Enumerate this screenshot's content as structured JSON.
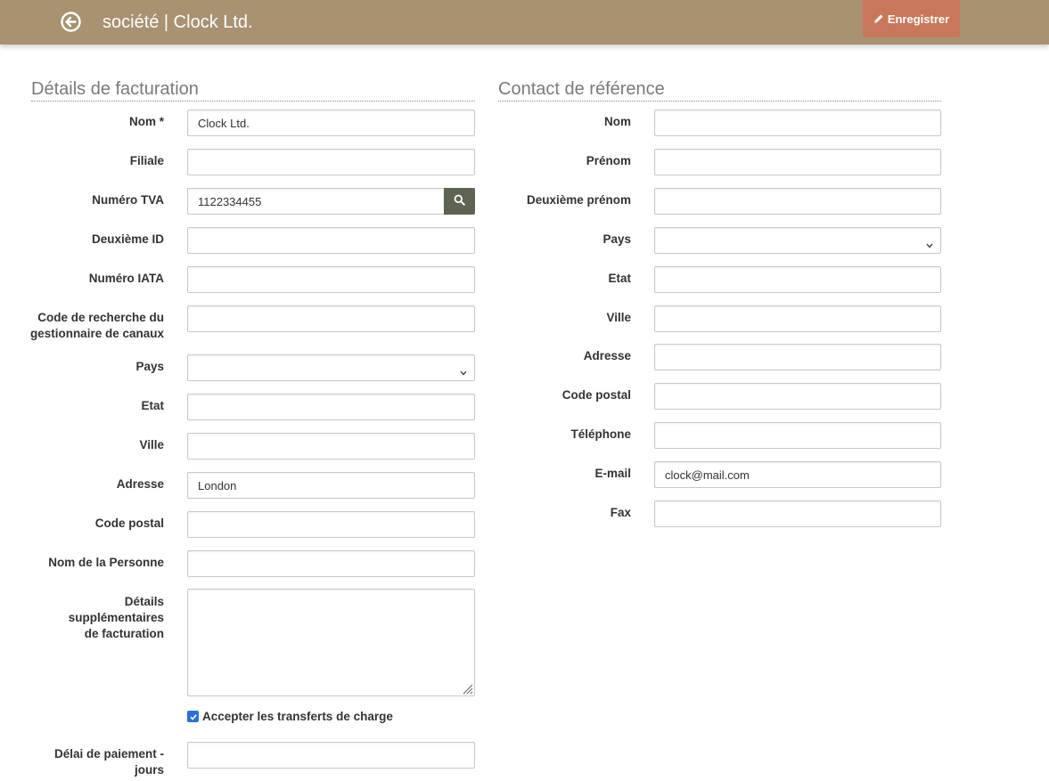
{
  "header": {
    "title": "société | Clock Ltd.",
    "back_icon": "back-circle-arrow-icon",
    "save_label": "Enregistrer",
    "save_icon": "pencil-icon",
    "bar_color": "#a89271",
    "save_color": "#c9775a"
  },
  "billing": {
    "section_title": "Détails de facturation",
    "fields": {
      "nom": {
        "label": "Nom *",
        "value": "Clock Ltd."
      },
      "filiale": {
        "label": "Filiale",
        "value": ""
      },
      "tva": {
        "label": "Numéro TVA",
        "value": "1122334455",
        "button_icon": "search-icon"
      },
      "deuxieme_id": {
        "label": "Deuxième ID",
        "value": ""
      },
      "iata": {
        "label": "Numéro IATA",
        "value": ""
      },
      "code_recherche": {
        "label_line1": "Code de recherche du",
        "label_line2": "gestionnaire de canaux",
        "value": ""
      },
      "pays": {
        "label": "Pays",
        "value": ""
      },
      "etat": {
        "label": "Etat",
        "value": ""
      },
      "ville": {
        "label": "Ville",
        "value": ""
      },
      "adresse": {
        "label": "Adresse",
        "value": "London"
      },
      "code_postal": {
        "label": "Code postal",
        "value": ""
      },
      "nom_personne": {
        "label": "Nom de la Personne",
        "value": ""
      },
      "details_supp": {
        "label_line1": "Détails supplémentaires",
        "label_line2": "de facturation",
        "value": ""
      },
      "transferts": {
        "label": "Accepter les transferts de charge",
        "checked": true
      },
      "delai": {
        "label_line1": "Délai de paiement -",
        "label_line2": "jours",
        "value": ""
      }
    }
  },
  "contact": {
    "section_title": "Contact de référence",
    "fields": {
      "nom": {
        "label": "Nom",
        "value": ""
      },
      "prenom": {
        "label": "Prénom",
        "value": ""
      },
      "deuxieme_prenom": {
        "label": "Deuxième prénom",
        "value": ""
      },
      "pays": {
        "label": "Pays",
        "value": ""
      },
      "etat": {
        "label": "Etat",
        "value": ""
      },
      "ville": {
        "label": "Ville",
        "value": ""
      },
      "adresse": {
        "label": "Adresse",
        "value": ""
      },
      "code_postal": {
        "label": "Code postal",
        "value": ""
      },
      "telephone": {
        "label": "Téléphone",
        "value": ""
      },
      "email": {
        "label": "E-mail",
        "value": "clock@mail.com"
      },
      "fax": {
        "label": "Fax",
        "value": ""
      }
    }
  }
}
